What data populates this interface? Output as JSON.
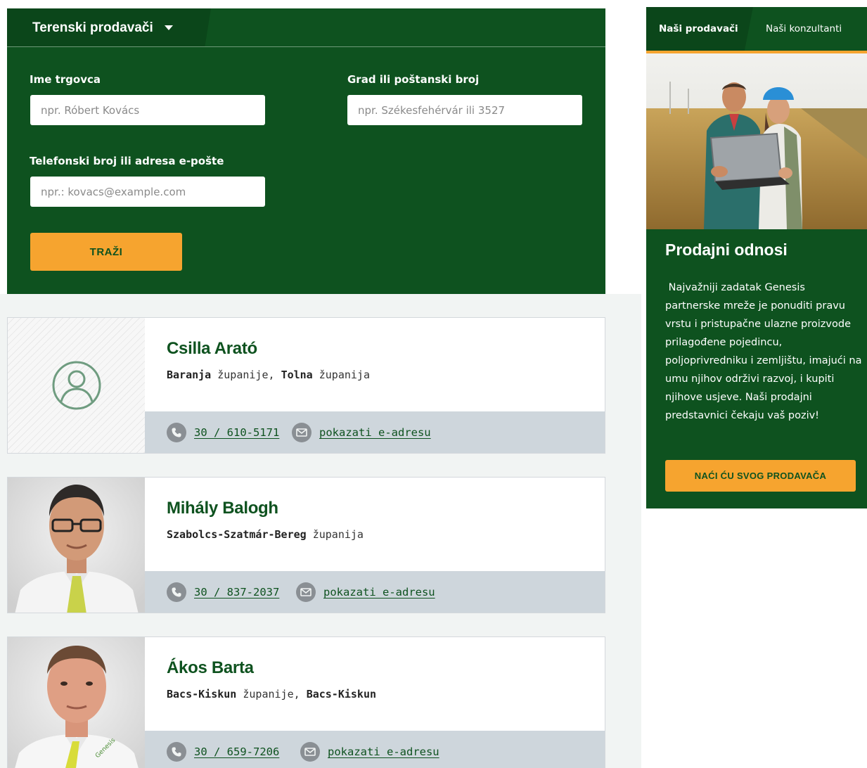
{
  "search": {
    "dropdown_label": "Terenski prodavači",
    "name_label": "Ime trgovca",
    "name_placeholder": "npr. Róbert Kovács",
    "city_label": "Grad ili poštanski broj",
    "city_placeholder": "npr. Székesfehérvár ili 3527",
    "contact_label": "Telefonski broj ili adresa e-pošte",
    "contact_placeholder": "npr.: kovacs@example.com",
    "button_label": "TRAŽI"
  },
  "sellers": [
    {
      "name": "Csilla Arató",
      "region_1_bold": "Baranja",
      "region_1_rest": " županije, ",
      "region_2_bold": "Tolna",
      "region_2_rest": " županija",
      "phone": "30 / 610-5171",
      "email_link": "pokazati e-adresu",
      "photo": "avatar-placeholder"
    },
    {
      "name": "Mihály Balogh",
      "region_1_bold": "Szabolcs-Szatmár-Bereg",
      "region_1_rest": " županija",
      "region_2_bold": "",
      "region_2_rest": "",
      "phone": "30 / 837-2037",
      "email_link": "pokazati e-adresu",
      "photo": "portrait"
    },
    {
      "name": "Ákos Barta",
      "region_1_bold": "Bacs-Kiskun",
      "region_1_rest": " županije, ",
      "region_2_bold": "Bacs-Kiskun",
      "region_2_rest": "",
      "phone": "30 / 659-7206",
      "email_link": "pokazati e-adresu",
      "photo": "portrait"
    }
  ],
  "sidebar": {
    "tab_active": "Naši prodavači",
    "tab_other": "Naši konzultanti",
    "title": "Prodajni odnosi",
    "text": " Najvažniji zadatak Genesis partnerske mreže je ponuditi pravu vrstu i pristupačne ulazne proizvode prilagođene pojedincu, poljoprivredniku i zemljištu, imajući na umu njihov održivi razvoj, i kupiti njihove usjeve. Naši prodajni predstavnici čekaju vaš poziv!",
    "button_label": "NAĆI ĆU SVOG PRODAVAČA"
  },
  "icons": {
    "phone": "phone-icon",
    "email": "envelope-icon",
    "avatar": "user-avatar-icon",
    "caret": "caret-down-icon"
  },
  "colors": {
    "brand_green": "#0e521f",
    "accent_orange": "#f6a42f",
    "footer_gray": "#ced6dc"
  }
}
